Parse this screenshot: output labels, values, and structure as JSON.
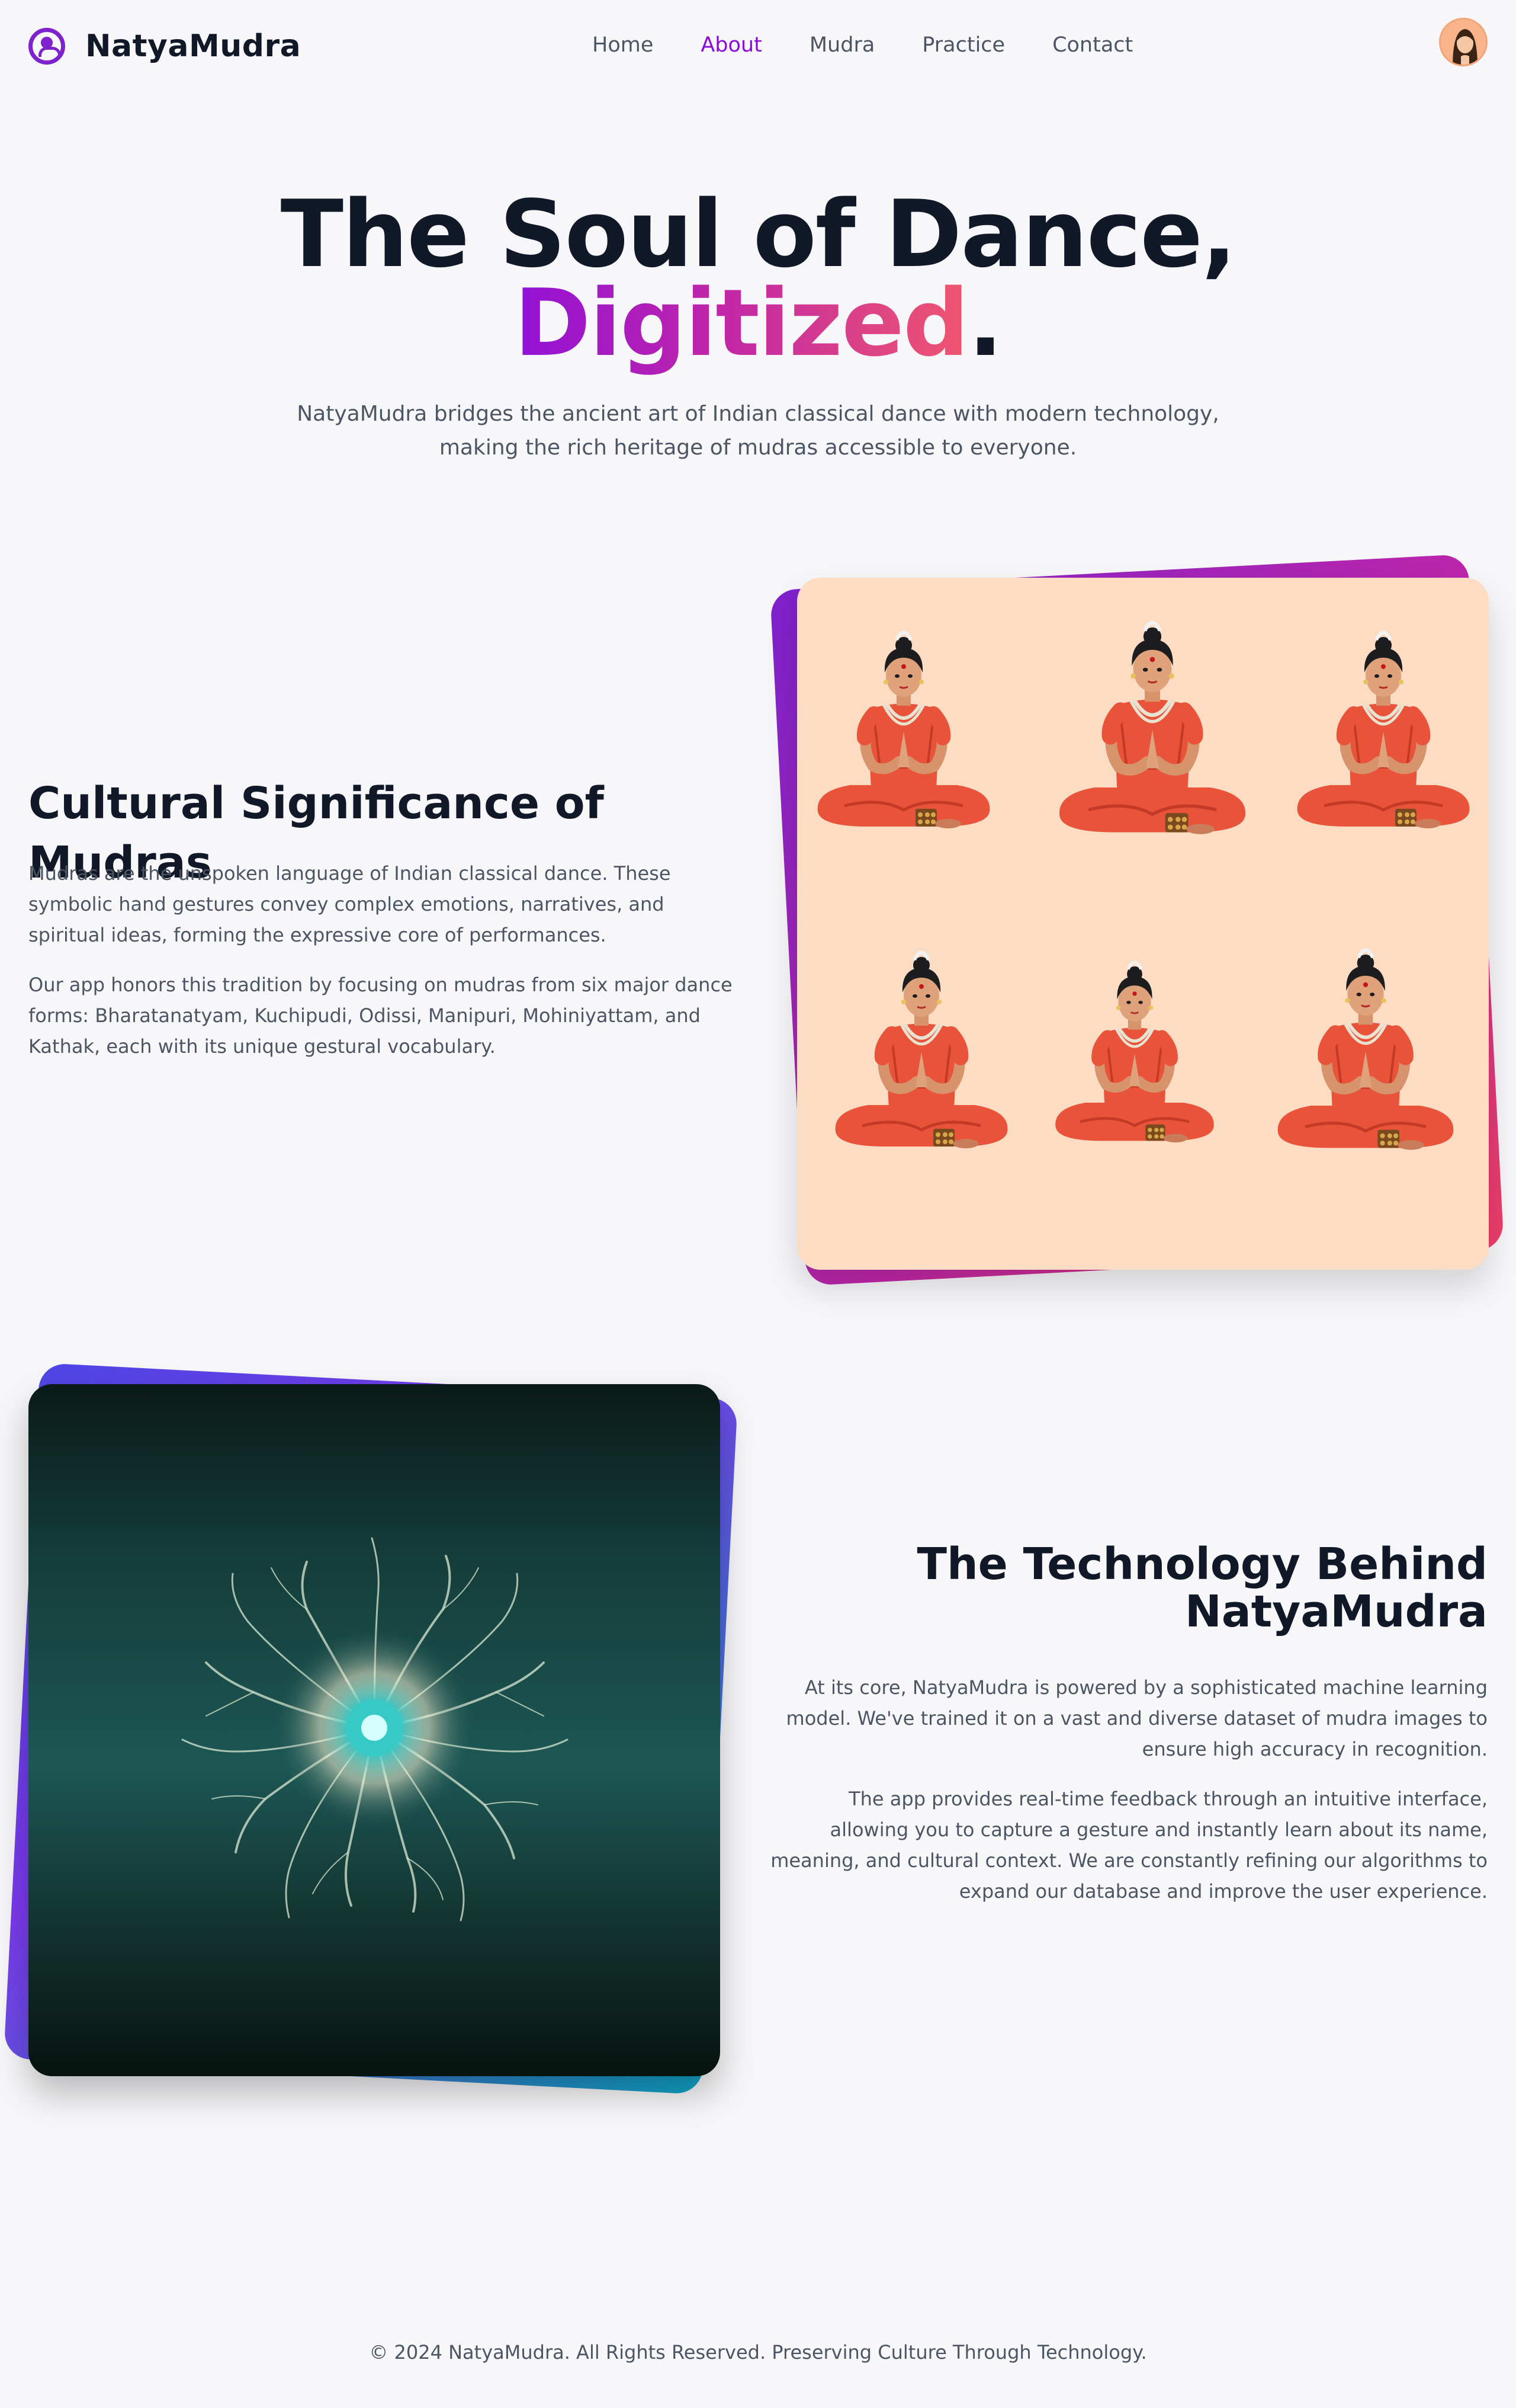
{
  "nav": {
    "brand": "NatyaMudra",
    "links": [
      {
        "label": "Home",
        "active": false
      },
      {
        "label": "About",
        "active": true
      },
      {
        "label": "Mudra",
        "active": false
      },
      {
        "label": "Practice",
        "active": false
      },
      {
        "label": "Contact",
        "active": false
      }
    ]
  },
  "hero": {
    "title_line1": "The Soul of Dance,",
    "title_highlight": "Digitized",
    "title_end": ".",
    "subtitle": "NatyaMudra bridges the ancient art of Indian classical dance with modern technology, making the rich heritage of mudras accessible to everyone."
  },
  "cultural": {
    "heading": "Cultural Significance of Mudras",
    "para1": "Mudras are the unspoken language of Indian classical dance. These symbolic hand gestures convey complex emotions, narratives, and spiritual ideas, forming the expressive core of performances.",
    "para2": "Our app honors this tradition by focusing on mudras from six major dance forms: Bharatanatyam, Kuchipudi, Odissi, Manipuri, Mohiniyattam, and Kathak, each with its unique gestural vocabulary."
  },
  "technology": {
    "heading": "The Technology Behind NatyaMudra",
    "para1": "At its core, NatyaMudra is powered by a sophisticated machine learning model. We've trained it on a vast and diverse dataset of mudra images to ensure high accuracy in recognition.",
    "para2": "The app provides real-time feedback through an intuitive interface, allowing you to capture a gesture and instantly learn about its name, meaning, and cultural context. We are constantly refining our algorithms to expand our database and improve the user experience."
  },
  "footer": {
    "text": "© 2024 NatyaMudra. All Rights Reserved. Preserving Culture Through Technology."
  },
  "colors": {
    "accent": "#8b0cd6",
    "gradient_start": "#9111d6",
    "gradient_end": "#f0566e",
    "text_dark": "#111827",
    "text_muted": "#4b5563",
    "background": "#f7f7f9"
  }
}
